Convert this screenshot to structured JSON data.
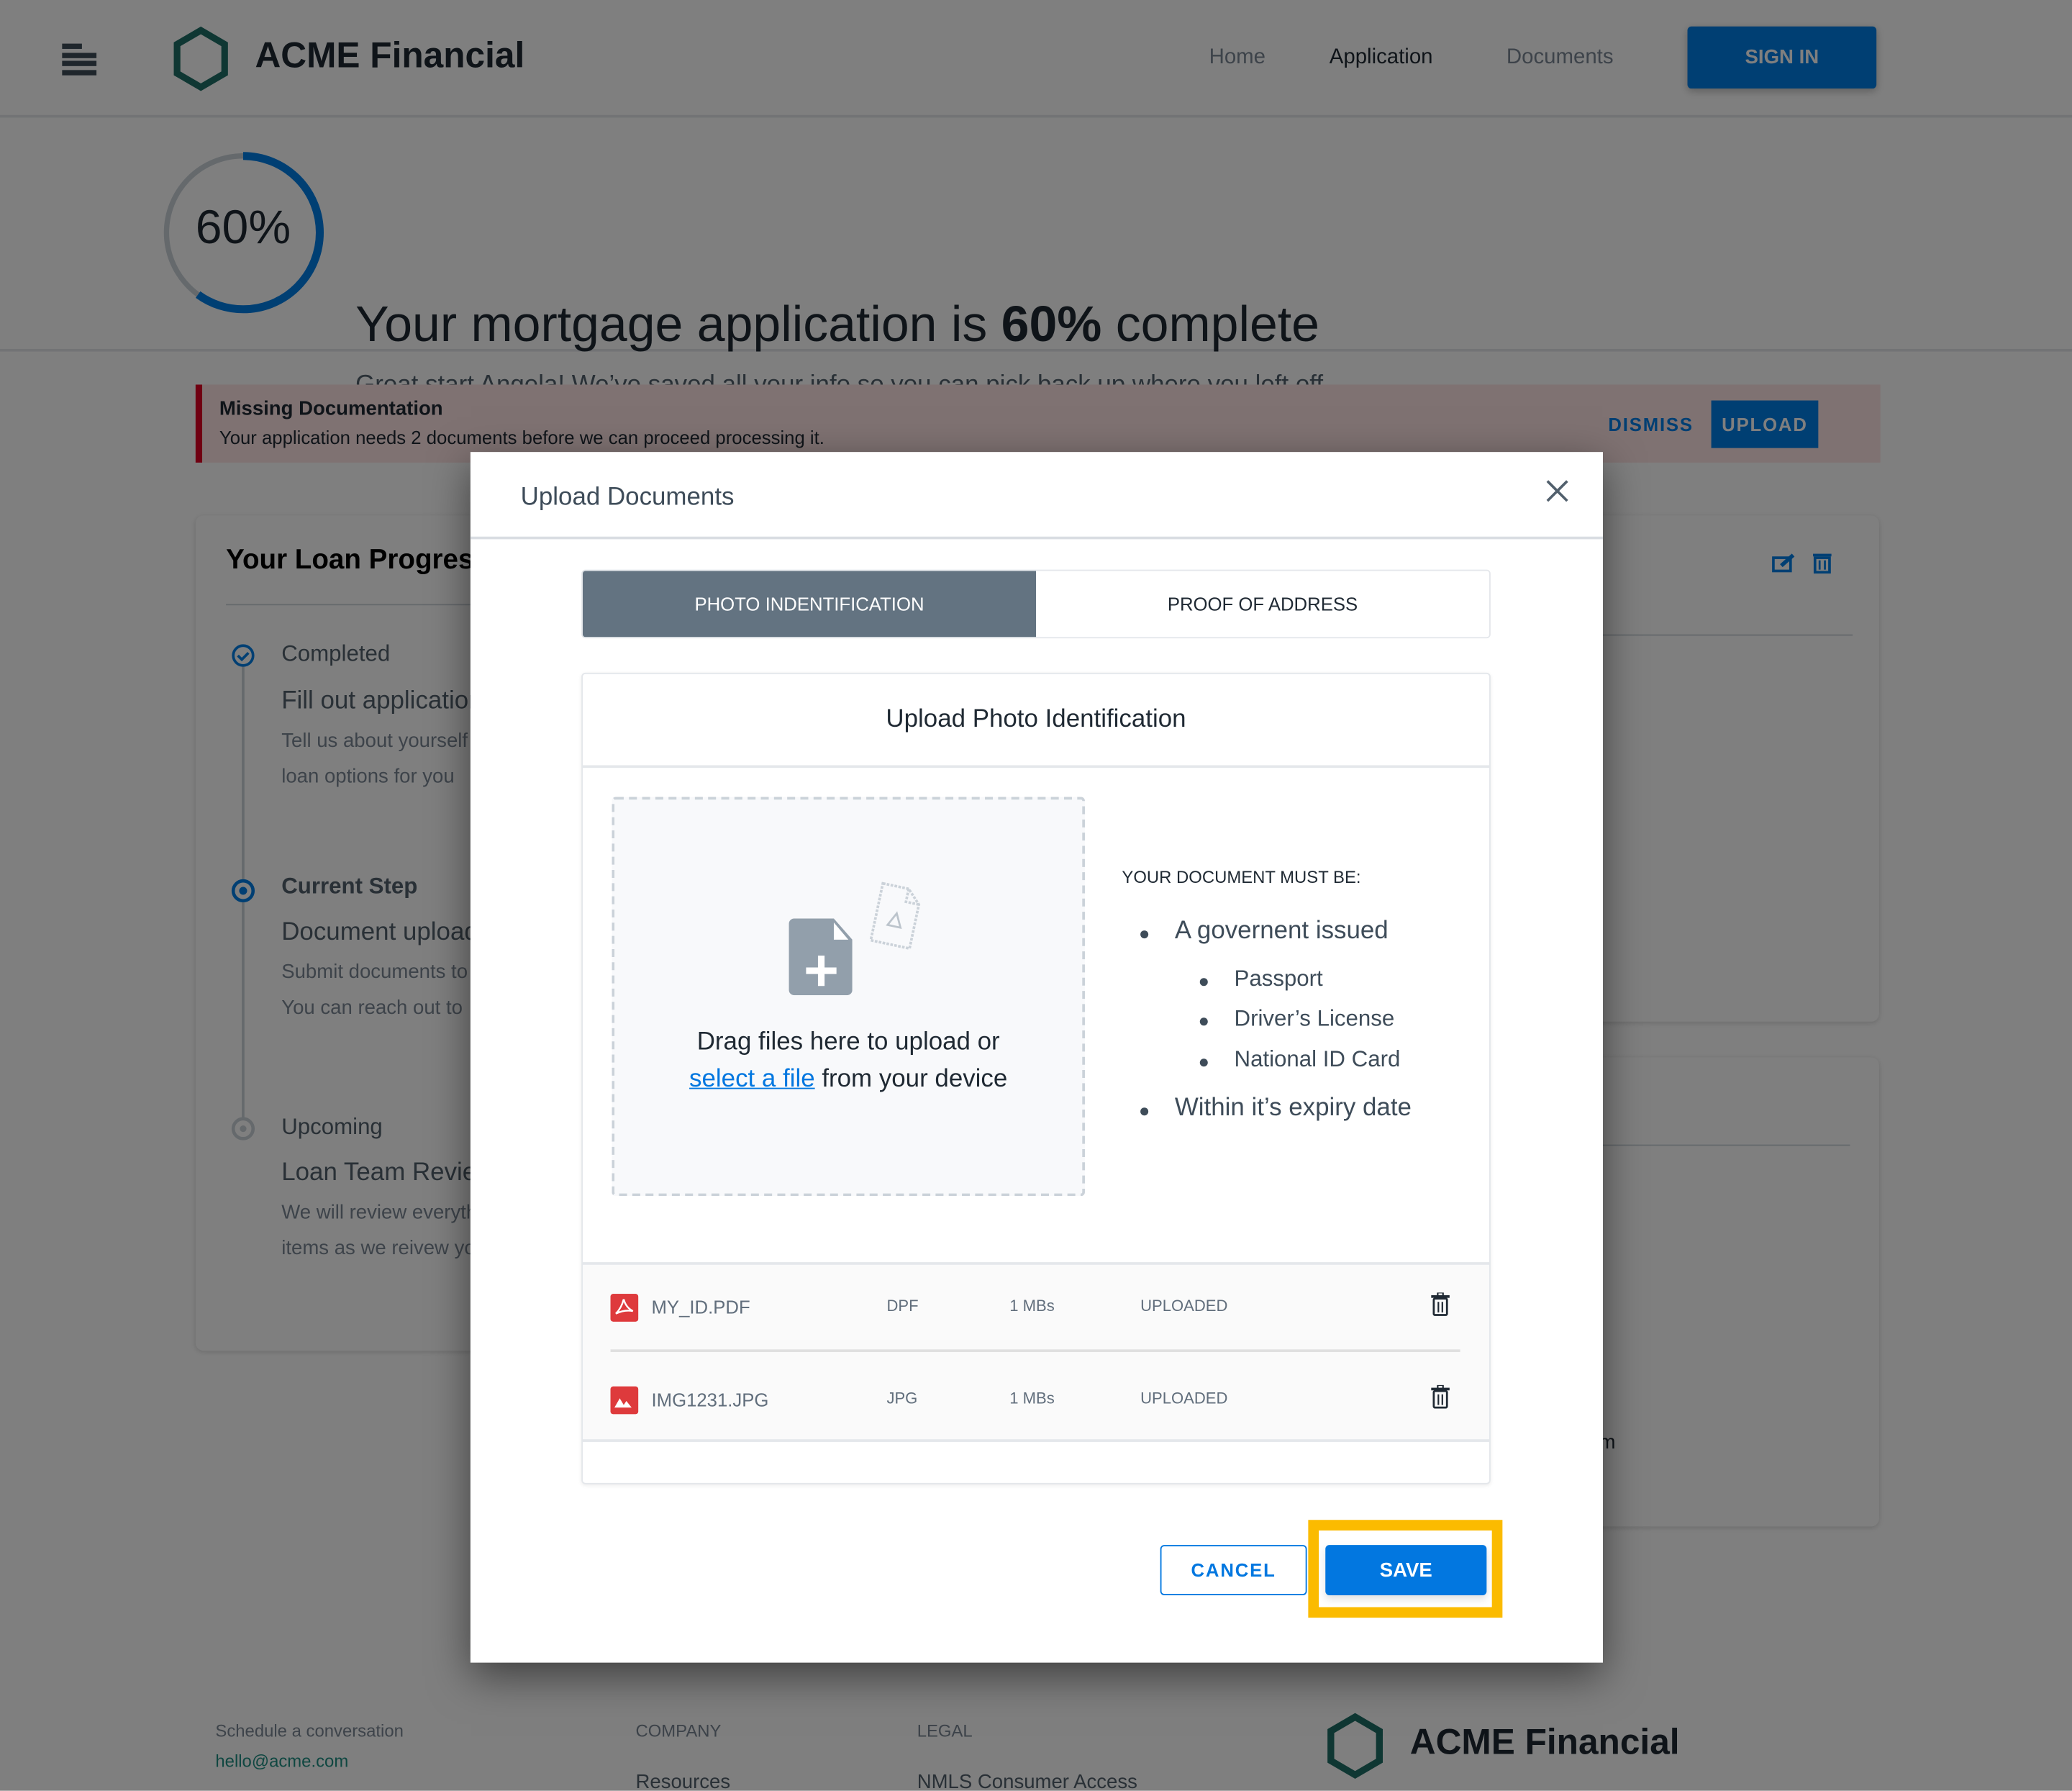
{
  "header": {
    "brand": "ACME Financial",
    "nav": [
      {
        "label": "Home"
      },
      {
        "label": "Application",
        "active": true
      },
      {
        "label": "Documents"
      }
    ],
    "sign_in": "SIGN IN"
  },
  "hero": {
    "progress_percent": 60,
    "progress_label": "60%",
    "title_prefix": "Your mortgage application is ",
    "title_bold": "60%",
    "title_suffix": " complete",
    "subtitle": "Great start Angela! We’ve saved all your info so you can pick back up where you left off."
  },
  "alert": {
    "title": "Missing Documentation",
    "message": "Your application needs 2 documents before we can proceed processing it.",
    "dismiss": "DISMISS",
    "upload": "UPLOAD"
  },
  "loan_progress": {
    "title": "Your Loan Progress",
    "steps": [
      {
        "status": "Completed",
        "title": "Fill out application",
        "desc1": "Tell us about yourself",
        "desc2": "loan options for you"
      },
      {
        "status": "Current Step",
        "title": "Document upload",
        "desc1": "Submit documents to",
        "desc2": "You can reach out to"
      },
      {
        "status": "Upcoming",
        "title": "Loan Team Review",
        "desc1": "We will review everything",
        "desc2": "items as we reivew your"
      }
    ]
  },
  "side_fragment": "m",
  "footer": {
    "schedule": "Schedule a conversation",
    "email": "hello@acme.com",
    "company_heading": "COMPANY",
    "company_link": "Resources",
    "legal_heading": "LEGAL",
    "legal_link": "NMLS Consumer Access",
    "brand": "ACME Financial"
  },
  "modal": {
    "title": "Upload Documents",
    "tabs": [
      {
        "label": "PHOTO INDENTIFICATION",
        "active": true
      },
      {
        "label": "PROOF OF ADDRESS"
      }
    ],
    "card_title": "Upload Photo Identification",
    "drop_text_1": "Drag files here to upload or",
    "drop_link": "select a file",
    "drop_text_2": " from your device",
    "requirements_heading": "YOUR DOCUMENT MUST BE:",
    "requirements": {
      "item1": "A governent issued",
      "sub": [
        "Passport",
        "Driver’s License",
        "National ID Card"
      ],
      "item2": "Within it’s expiry date"
    },
    "files": [
      {
        "name": "MY_ID.PDF",
        "type": "DPF",
        "size": "1 MBs",
        "status": "UPLOADED",
        "icon": "pdf-icon"
      },
      {
        "name": "IMG1231.JPG",
        "type": "JPG",
        "size": "1 MBs",
        "status": "UPLOADED",
        "icon": "image-icon"
      }
    ],
    "cancel": "CANCEL",
    "save": "SAVE"
  },
  "colors": {
    "primary": "#0277e0",
    "highlight": "#fbbb00",
    "brand_teal": "#1f6f66",
    "tab_active": "#637381",
    "file_icon": "#de3a3c"
  }
}
